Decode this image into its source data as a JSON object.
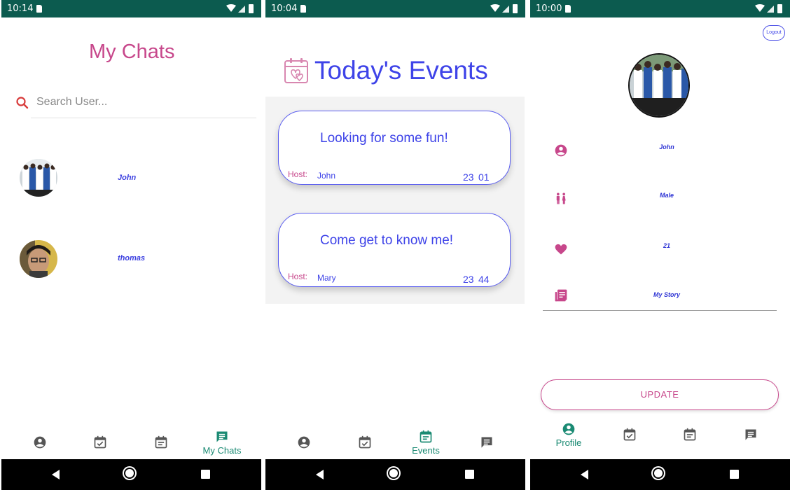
{
  "screens": [
    {
      "status_time": "10:14",
      "title": "My Chats",
      "search_placeholder": "Search User...",
      "chats": [
        {
          "name": "John"
        },
        {
          "name": "thomas"
        }
      ],
      "nav_active_label": "My Chats"
    },
    {
      "status_time": "10:04",
      "title": "Today's Events",
      "events": [
        {
          "title": "Looking for some fun!",
          "host_label": "Host:",
          "host": "John",
          "hour": "23",
          "minute": "01"
        },
        {
          "title": "Come get to know me!",
          "host_label": "Host:",
          "host": "Mary",
          "hour": "23",
          "minute": "44"
        }
      ],
      "nav_active_label": "Events"
    },
    {
      "status_time": "10:00",
      "logout_label": "Logout",
      "profile": {
        "name": "John",
        "gender": "Male",
        "age": "21",
        "story": "My Story"
      },
      "update_label": "UPDATE",
      "nav_active_label": "Profile"
    }
  ],
  "colors": {
    "status_bar": "#0c5b4f",
    "accent_pink": "#c7478b",
    "accent_blue": "#3e43e8",
    "nav_active": "#1a8a73",
    "nav_inactive": "#555555"
  },
  "icons": {
    "nav": [
      "account-circle-icon",
      "calendar-check-icon",
      "calendar-event-icon",
      "chat-icon"
    ],
    "profile": [
      "account-circle-icon",
      "gender-icon",
      "heart-icon",
      "newspaper-icon"
    ]
  }
}
